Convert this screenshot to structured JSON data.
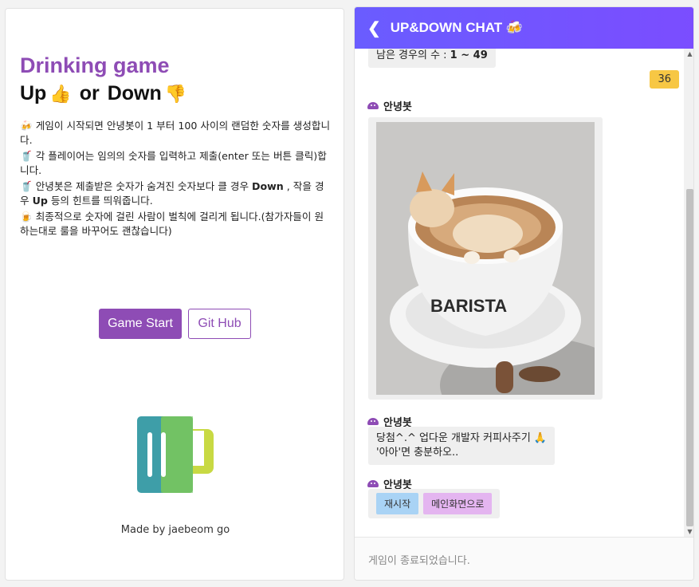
{
  "left": {
    "title": "Drinking game",
    "subtitle_up": "Up",
    "subtitle_or": "or",
    "subtitle_down": "Down",
    "rules": [
      {
        "icon": "🍻",
        "text": "게임이 시작되면 안녕봇이 1 부터 100 사이의 랜덤한 숫자를 생성합니다."
      },
      {
        "icon": "🥤",
        "text": "각 플레이어는 임의의 숫자를 입력하고 제출(enter 또는 버튼 클릭)합니다."
      },
      {
        "icon": "🥤",
        "text_a": "안녕봇은 제출받은 숫자가 숨겨진 숫자보다 클 경우 ",
        "bold_down": "Down",
        "text_b": " , 작을 경우 ",
        "bold_up": "Up",
        "text_c": " 등의 힌트를 띄워줍니다."
      },
      {
        "icon": "🍺",
        "text": "최종적으로 숫자에 걸린 사람이 벌칙에 걸리게 됩니다.(참가자들이 원하는대로 룰을 바꾸어도 괜찮습니다)"
      }
    ],
    "start_button": "Game Start",
    "github_button": "Git Hub",
    "made_by": "Made by jaebeom go",
    "colors": {
      "accent": "#8e4cb5"
    }
  },
  "chat": {
    "header_title": "UP&DOWN CHAT 🍻",
    "range_text_prefix": "남은 경우의 수 : ",
    "range_value": "1 ~ 49",
    "my_message": "36",
    "bot_name": "안녕봇",
    "bot_message_line1": "당첨^.^ 업다운 개발자 커피사주기 🙏",
    "bot_message_line2": "'아아'면 충분하오..",
    "restart_button": "재시작",
    "main_button": "메인화면으로",
    "footer_text": "게임이 종료되었습니다.",
    "colors": {
      "header": "#6a5cff",
      "my_bubble": "#f7c744",
      "chip_restart": "#a9d3f5",
      "chip_main": "#e4b5f0"
    }
  }
}
